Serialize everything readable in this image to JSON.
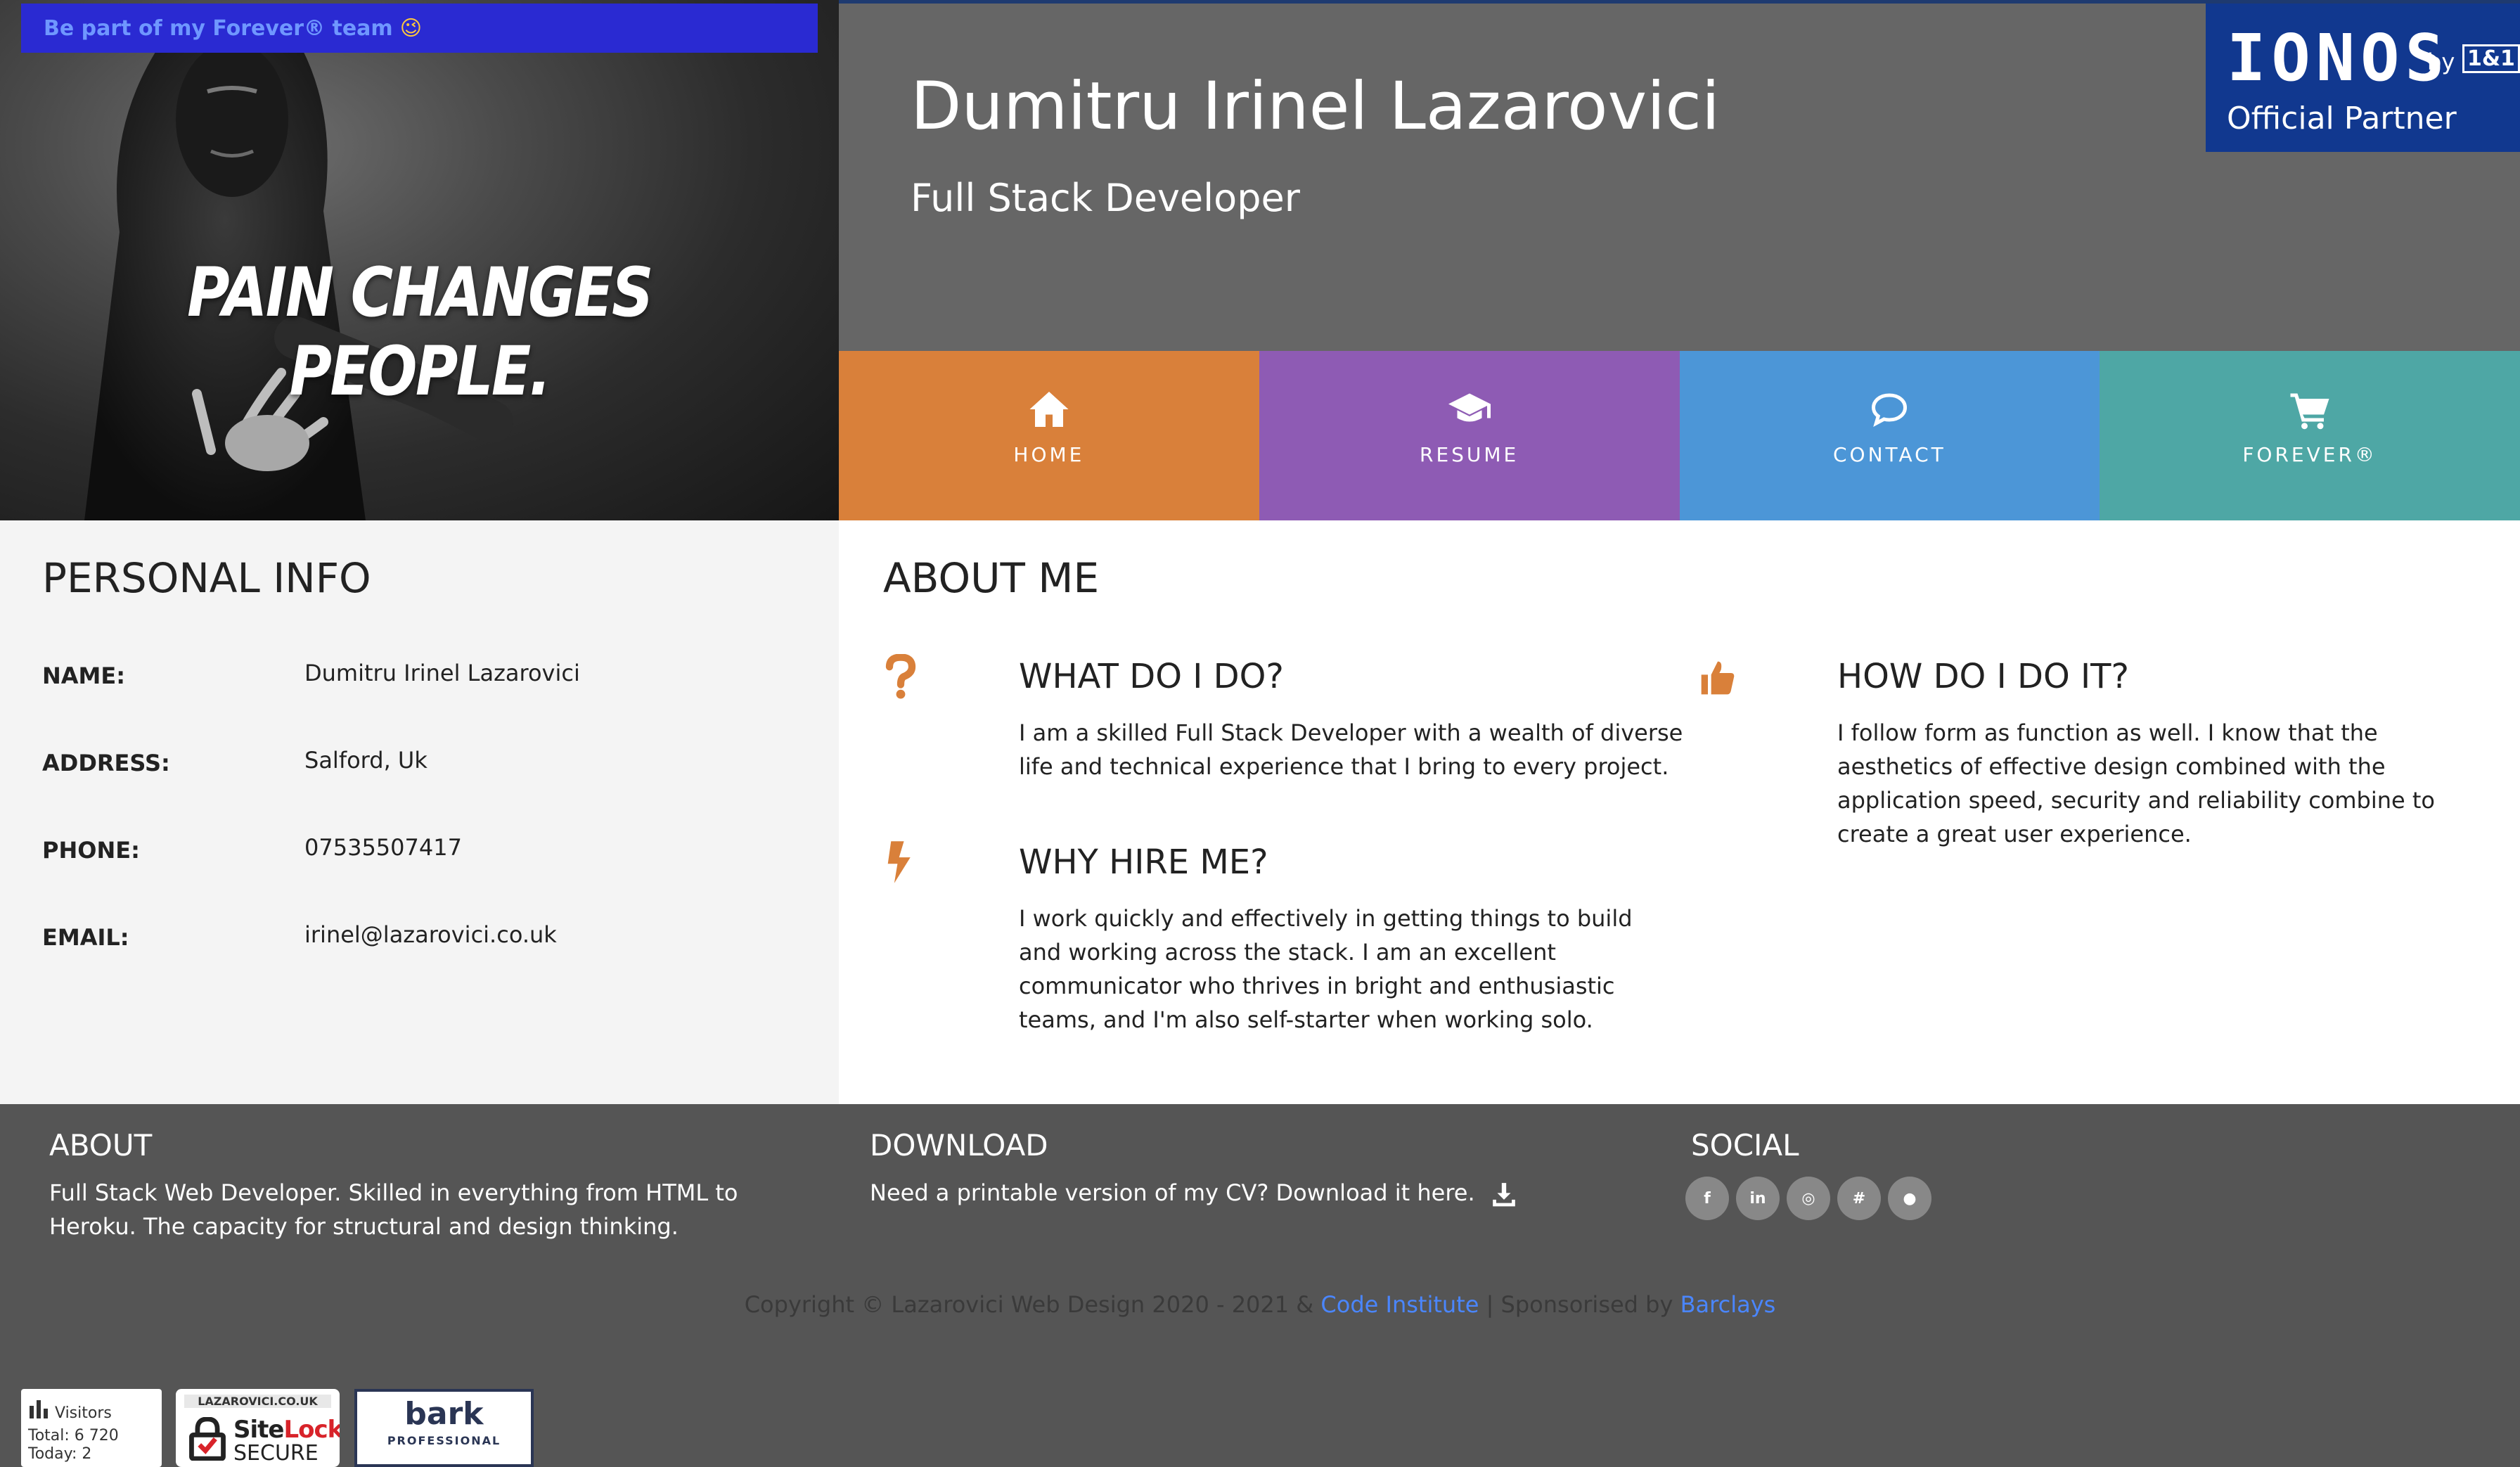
{
  "hero": {
    "slogan": "PAIN CHANGES PEOPLE.",
    "team_link": "Be part of my Forever® team",
    "team_emoji": "😉"
  },
  "header": {
    "name": "Dumitru Irinel Lazarovici",
    "job_title": "Full Stack Developer",
    "partner": {
      "logo": "IONOS",
      "by": "by",
      "badge": "1&1",
      "subtitle": "Official Partner"
    }
  },
  "nav": [
    {
      "label": "HOME",
      "icon": "home-icon",
      "color": "#d9803a"
    },
    {
      "label": "RESUME",
      "icon": "graduation-cap-icon",
      "color": "#8e5bb4"
    },
    {
      "label": "CONTACT",
      "icon": "chat-icon",
      "color": "#4c96d7"
    },
    {
      "label": "FOREVER®",
      "icon": "cart-icon",
      "color": "#4ea7a5"
    }
  ],
  "personal": {
    "title": "PERSONAL INFO",
    "rows": [
      {
        "label": "NAME:",
        "value": "Dumitru Irinel Lazarovici"
      },
      {
        "label": "ADDRESS:",
        "value": "Salford, Uk"
      },
      {
        "label": "PHONE:",
        "value": "07535507417"
      },
      {
        "label": "EMAIL:",
        "value": "irinel@lazarovici.co.uk"
      }
    ]
  },
  "about": {
    "title": "ABOUT ME",
    "features": [
      {
        "icon": "question-icon",
        "title": "WHAT DO I DO?",
        "text": "I am a skilled Full Stack Developer with a wealth of diverse life and technical experience that I bring to every project."
      },
      {
        "icon": "bolt-icon",
        "title": "WHY HIRE ME?",
        "text": "I work quickly and effectively in getting things to build and working across the stack. I am an excellent communicator who thrives in bright and enthusiastic teams, and I'm also self-starter when working solo."
      },
      {
        "icon": "thumbs-up-icon",
        "title": "HOW DO I DO IT?",
        "text": "I follow form as function as well. I know that the aesthetics of effective design combined with the application speed, security and reliability combine to create a great user experience."
      }
    ],
    "accent": "#d9803a"
  },
  "footer": {
    "about_title": "ABOUT",
    "about_text": "Full Stack Web Developer. Skilled in everything from HTML to Heroku. The capacity for structural and design thinking.",
    "download_title": "DOWNLOAD",
    "download_text": "Need a printable version of my CV? Download it here.",
    "social_title": "SOCIAL",
    "social": [
      {
        "icon": "facebook-icon",
        "glyph": "f"
      },
      {
        "icon": "linkedin-icon",
        "glyph": "in"
      },
      {
        "icon": "instagram-icon",
        "glyph": "◎"
      },
      {
        "icon": "slack-icon",
        "glyph": "#"
      },
      {
        "icon": "github-icon",
        "glyph": "●"
      }
    ],
    "copyright_prefix": "Copyright © Lazarovici Web Design 2020 - 2021 &",
    "copyright_link1": "Code Institute",
    "copyright_mid": "| Sponsorised by",
    "copyright_link2": "Barclays"
  },
  "badges": {
    "visitors_title": "Visitors",
    "visitors_total": "Total: 6 720",
    "visitors_today": "Today: 2",
    "sitelock_domain": "LAZAROVICI.CO.UK",
    "sitelock_brand_a": "Site",
    "sitelock_brand_b": "Lock",
    "sitelock_secure": "SECURE",
    "bark_name": "bark",
    "bark_sub": "PROFESSIONAL"
  }
}
